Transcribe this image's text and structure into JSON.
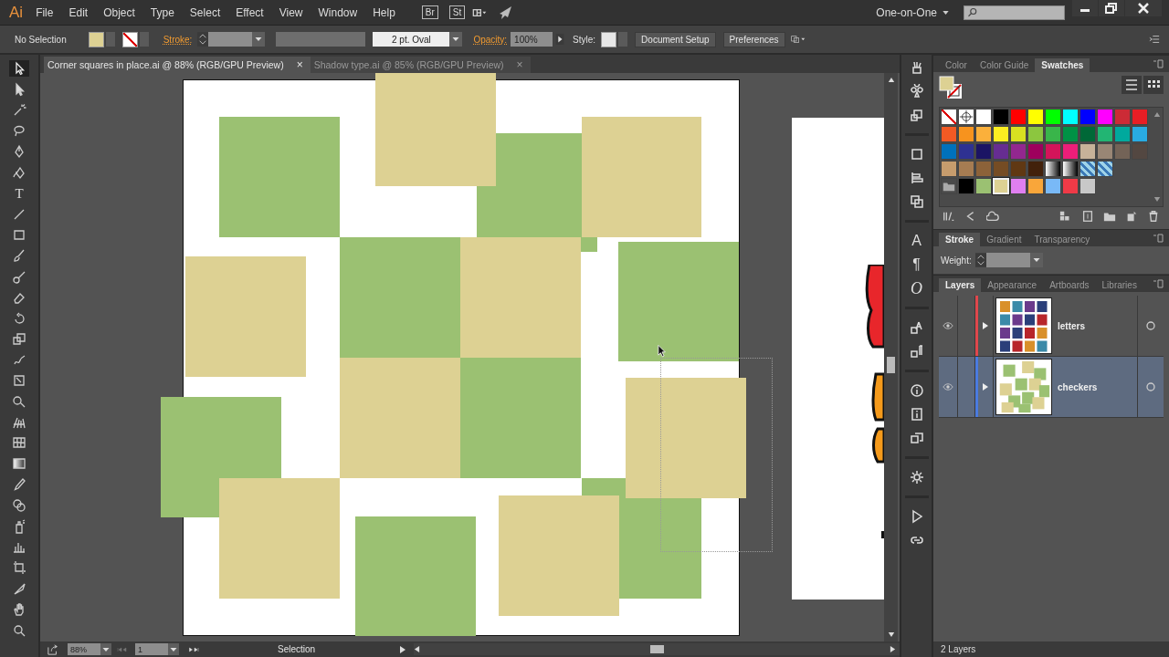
{
  "app_logo": "Ai",
  "menu": [
    "File",
    "Edit",
    "Object",
    "Type",
    "Select",
    "Effect",
    "View",
    "Window",
    "Help"
  ],
  "bridge_buttons": [
    "Br",
    "St"
  ],
  "workspace": "One-on-One",
  "control_bar": {
    "selection": "No Selection",
    "stroke_label": "Stroke:",
    "brush": "2 pt. Oval",
    "opacity_label": "Opacity:",
    "opacity": "100%",
    "style_label": "Style:",
    "buttons": [
      "Document Setup",
      "Preferences"
    ]
  },
  "document_tabs": [
    {
      "title": "Corner squares in place.ai @ 88% (RGB/GPU Preview)",
      "close": "×",
      "selected": true
    },
    {
      "title": "Shadow type.ai @ 85% (RGB/GPU Preview)",
      "close": "×",
      "selected": false
    }
  ],
  "tools": {
    "type_tool": "T"
  },
  "panel_icons": {
    "character": "A",
    "paragraph": "¶",
    "opentype": "O"
  },
  "swatches_panel": {
    "tabs": [
      {
        "label": "Color",
        "selected": false
      },
      {
        "label": "Color Guide",
        "selected": false
      },
      {
        "label": "Swatches",
        "selected": true
      }
    ],
    "swatches": [
      {
        "kind": "none",
        "selected": false
      },
      {
        "kind": "registration",
        "selected": false
      },
      {
        "kind": "solid",
        "color": "#ffffff",
        "selected": false
      },
      {
        "kind": "solid",
        "color": "#000000",
        "selected": false
      },
      {
        "kind": "solid",
        "color": "#ff0000",
        "selected": false
      },
      {
        "kind": "solid",
        "color": "#ffff00",
        "selected": false
      },
      {
        "kind": "solid",
        "color": "#00ff00",
        "selected": false
      },
      {
        "kind": "solid",
        "color": "#00ffff",
        "selected": false
      },
      {
        "kind": "solid",
        "color": "#0000ff",
        "selected": false
      },
      {
        "kind": "solid",
        "color": "#ff00ff",
        "selected": false
      },
      {
        "kind": "solid",
        "color": "#cc2b36",
        "selected": false
      },
      {
        "kind": "solid",
        "color": "#e81e25",
        "selected": false
      },
      {
        "kind": "solid",
        "color": "#f15a24",
        "selected": false
      },
      {
        "kind": "solid",
        "color": "#f7931e",
        "selected": false
      },
      {
        "kind": "solid",
        "color": "#fbb03b",
        "selected": false
      },
      {
        "kind": "solid",
        "color": "#fcee21",
        "selected": false
      },
      {
        "kind": "solid",
        "color": "#d9e021",
        "selected": false
      },
      {
        "kind": "solid",
        "color": "#8cc63f",
        "selected": false
      },
      {
        "kind": "solid",
        "color": "#39b54a",
        "selected": false
      },
      {
        "kind": "solid",
        "color": "#009245",
        "selected": false
      },
      {
        "kind": "solid",
        "color": "#006837",
        "selected": false
      },
      {
        "kind": "solid",
        "color": "#22b573",
        "selected": false
      },
      {
        "kind": "solid",
        "color": "#00a99d",
        "selected": false
      },
      {
        "kind": "solid",
        "color": "#29abe2",
        "selected": false
      },
      {
        "kind": "solid",
        "color": "#0071bc",
        "selected": false
      },
      {
        "kind": "solid",
        "color": "#2e3192",
        "selected": false
      },
      {
        "kind": "solid",
        "color": "#1b1464",
        "selected": false
      },
      {
        "kind": "solid",
        "color": "#662d91",
        "selected": false
      },
      {
        "kind": "solid",
        "color": "#93278f",
        "selected": false
      },
      {
        "kind": "solid",
        "color": "#9e005d",
        "selected": false
      },
      {
        "kind": "solid",
        "color": "#d4145a",
        "selected": false
      },
      {
        "kind": "solid",
        "color": "#ed1e79",
        "selected": false
      },
      {
        "kind": "solid",
        "color": "#c7b299",
        "selected": false
      },
      {
        "kind": "solid",
        "color": "#998675",
        "selected": false
      },
      {
        "kind": "solid",
        "color": "#736357",
        "selected": false
      },
      {
        "kind": "solid",
        "color": "#534741",
        "selected": false
      },
      {
        "kind": "solid",
        "color": "#c69c6d",
        "selected": false
      },
      {
        "kind": "solid",
        "color": "#a67c52",
        "selected": false
      },
      {
        "kind": "solid",
        "color": "#8c6239",
        "selected": false
      },
      {
        "kind": "solid",
        "color": "#754c24",
        "selected": false
      },
      {
        "kind": "solid",
        "color": "#603813",
        "selected": false
      },
      {
        "kind": "solid",
        "color": "#42210b",
        "selected": false
      },
      {
        "kind": "gradient",
        "selected": false
      },
      {
        "kind": "gradient",
        "selected": false
      },
      {
        "kind": "pattern",
        "selected": false
      },
      {
        "kind": "pattern",
        "selected": false
      },
      {
        "kind": "folder",
        "selected": false
      },
      {
        "kind": "group",
        "color": "#000000",
        "selected": false
      },
      {
        "kind": "group",
        "color": "#9bc172",
        "selected": false
      },
      {
        "kind": "group",
        "color": "#ddd193",
        "selected": true
      },
      {
        "kind": "group",
        "color": "#e07ff0",
        "selected": false
      },
      {
        "kind": "group",
        "color": "#f9a63a",
        "selected": false
      },
      {
        "kind": "group",
        "color": "#79b9f7",
        "selected": false
      },
      {
        "kind": "group",
        "color": "#ef3a47",
        "selected": false
      },
      {
        "kind": "group",
        "color": "#c8c8c8",
        "selected": false
      }
    ]
  },
  "stroke_panel": {
    "tabs": [
      {
        "label": "Stroke",
        "selected": true
      },
      {
        "label": "Gradient",
        "selected": false
      },
      {
        "label": "Transparency",
        "selected": false
      }
    ],
    "weight_label": "Weight:"
  },
  "layers_panel": {
    "tabs": [
      {
        "label": "Layers",
        "selected": true
      },
      {
        "label": "Appearance",
        "selected": false
      },
      {
        "label": "Artboards",
        "selected": false
      },
      {
        "label": "Libraries",
        "selected": false
      }
    ],
    "layers": [
      {
        "name": "letters",
        "color": "#e0474c",
        "visible": true,
        "expanded": false,
        "selected": false
      },
      {
        "name": "checkers",
        "color": "#4a7be0",
        "visible": true,
        "expanded": false,
        "selected": true
      }
    ],
    "footer": "2 Layers"
  },
  "status_bar": {
    "zoom": "88%",
    "artboard": "1",
    "tool": "Selection"
  }
}
